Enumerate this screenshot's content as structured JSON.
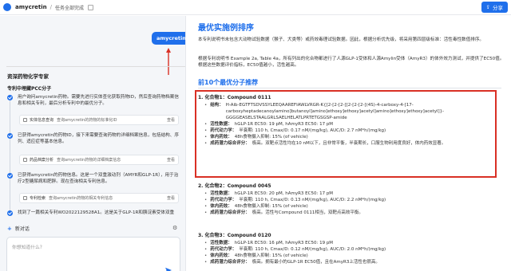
{
  "topbar": {
    "title": "amycretin",
    "separator": "/",
    "subtitle": "任务全部完成",
    "share_label": "分享"
  },
  "chat": {
    "user_message": "amycretin",
    "role_title": "资深药物化学专家",
    "section_title": "专利中埋藏PCC分子",
    "steps": [
      {
        "text": "用户询问amycretin药物。需要先进行实体查化获取药物ID，然后查询药物档案信息和相关专利，最后分析专利中的最优分子。"
      },
      {
        "text": "已获得amycretin的药物ID，接下来需要查询药物的详细档案信息，包括结构、序列、适应症等基本信息。"
      },
      {
        "text": "已获得amycretin的药物信息。这是一个双重激动剂（AMYR和GLP-1R），用于治疗2型糖尿病和肥胖。现在查询相关专利信息。"
      },
      {
        "text": "找到了一篇相关专利WO2022129528A1。这是关于GLP-1R和胰淀素受体双重"
      }
    ],
    "tools": [
      {
        "name": "实体信息查询",
        "desc": "查询amycretin的药物的标准化ID",
        "view": "查看"
      },
      {
        "name": "药品档案分析",
        "desc": "查询amycretin药物的详细档案信息",
        "view": "查看"
      },
      {
        "name": "专利检索",
        "desc": "查询amycretin药物的相关专利信息",
        "view": "查看"
      }
    ],
    "new_chat_label": "新对话",
    "input_placeholder": "你想知道什么?"
  },
  "doc": {
    "title": "最优实施例排序",
    "para1": "本专利说明书未包含大动物试验数据（猴子、犬类等）或药效毒理试验数据。因此，根据分析优先级，将采用第四层级标准：活性毒性数值排序。",
    "para2": "根据专利说明书 Example 2a, Table 4a，所有列出的化合物都进行了人源GLP-1受体和人源Amylin受体（AmyR3）的体外效力测试，并提供了EC50值。根据这些数据评价指标，EC50值越小，活性越高。",
    "section_title": "前10个最优分子推荐",
    "compounds": [
      {
        "head": "1. 化合物1：Compound 0111",
        "rows": [
          {
            "k": "结构：",
            "v": "H-Aib-EGTFTSDVSSYLEEQAAREFIAWLVRGR-K{[2-[2-[2-[[2-[2-[2-[(4S)-4-carboxy-4-[17-carboxyheptadecanoylamino]butanoyl]amino]ethoxy]ethoxy]acetyl]amino]ethoxy]ethoxy]acetyl]}-GGGGEASELSTAALGRLSAELHELATLPRTETGSGSP-amide"
          },
          {
            "k": "活性数据：",
            "v": "hGLP-1R EC50: 19 pM, hAmyR3 EC50: 17 pM"
          },
          {
            "k": "药代动力学：",
            "v": "半衰期: 110 h, Cmax/D: 0.17 nM/(mg/kg), AUC/D: 2.7 nM*h/(mg/kg)"
          },
          {
            "k": "体内药效：",
            "v": "48h食物摄入抑制: 15% (of vehicle)"
          },
          {
            "k": "成药潜力综合评分：",
            "v": "极高。双靶点活性均在10 nM以下，且非常平衡，半衰期长，口服生物利用度良好，体内药效显著。"
          }
        ]
      },
      {
        "head": "2. 化合物2：Compound 0045",
        "rows": [
          {
            "k": "活性数据：",
            "v": "hGLP-1R EC50: 20 pM, hAmyR3 EC50: 17 pM"
          },
          {
            "k": "药代动力学：",
            "v": "半衰期: 110 h, Cmax/D: 0.13 nM/(mg/kg), AUC/D: 2.2 nM*h/(mg/kg)"
          },
          {
            "k": "体内药效：",
            "v": "48h食物摄入抑制: 15% (of vehicle)"
          },
          {
            "k": "成药潜力综合评分：",
            "v": "极高。活性与Compound 0111相当，双靶点高效平衡。"
          }
        ]
      },
      {
        "head": "3. 化合物3：Compound 0120",
        "rows": [
          {
            "k": "活性数据：",
            "v": "hGLP-1R EC50: 16 pM, hAmyR3 EC50: 19 pM"
          },
          {
            "k": "药代动力学：",
            "v": "半衰期: 110 h, Cmax/D: 0.12 nM/(mg/kg), AUC/D: 2.0 nM*h/(mg/kg)"
          },
          {
            "k": "体内药效：",
            "v": "48h食物摄入抑制: 15% (of vehicle)"
          },
          {
            "k": "成药潜力综合评分：",
            "v": "极高。拥有最小的GLP-1R EC50值，且在AmyR3上活性也很高。"
          }
        ]
      }
    ]
  },
  "colors": {
    "accent": "#1f6feb",
    "highlight_border": "#d93025"
  }
}
